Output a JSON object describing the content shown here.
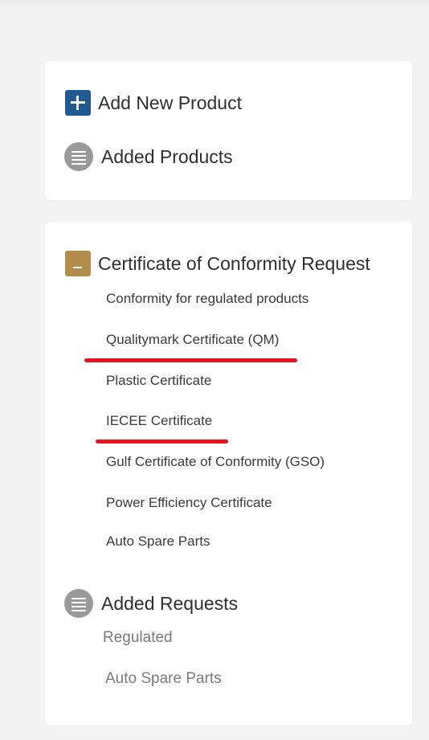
{
  "products_menu": {
    "add_new_product": "Add New Product",
    "added_products": "Added Products",
    "add_icon": "plus-icon",
    "list_icon": "list-icon"
  },
  "requests_menu": {
    "certificate_request": "Certificate of Conformity Request",
    "collapse_icon": "minus-icon",
    "certificate_items": [
      "Conformity for regulated products",
      "Qualitymark Certificate (QM)",
      "Plastic Certificate",
      "IECEE Certificate",
      "Gulf Certificate of Conformity (GSO)",
      "Power Efficiency Certificate",
      "Auto Spare Parts"
    ],
    "added_requests": "Added Requests",
    "added_request_items": [
      "Regulated",
      "Auto Spare Parts"
    ]
  },
  "colors": {
    "add_icon_bg": "#1f5a94",
    "collapse_icon_bg": "#b48d4b",
    "list_icon_bg": "#9a9a9a",
    "underline_annotation": "#e8121f"
  }
}
